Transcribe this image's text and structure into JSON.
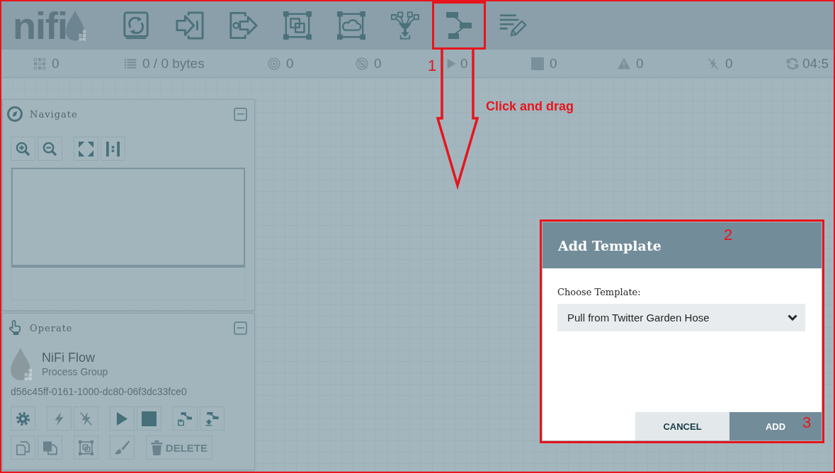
{
  "header": {
    "logo": "nifi",
    "toolbar": [
      {
        "kind": "processor",
        "highlighted": false
      },
      {
        "kind": "input-port",
        "highlighted": false
      },
      {
        "kind": "output-port",
        "highlighted": false
      },
      {
        "kind": "process-group",
        "highlighted": false
      },
      {
        "kind": "remote-process-group",
        "highlighted": false
      },
      {
        "kind": "funnel",
        "highlighted": false
      },
      {
        "kind": "template",
        "highlighted": true
      },
      {
        "kind": "label",
        "highlighted": false
      }
    ]
  },
  "status_bar": [
    {
      "kind": "components",
      "value": "0"
    },
    {
      "kind": "queued",
      "value": "0 / 0 bytes"
    },
    {
      "kind": "transmitting",
      "value": "0"
    },
    {
      "kind": "not-transmitting",
      "value": "0"
    },
    {
      "kind": "running",
      "value": "0"
    },
    {
      "kind": "stopped",
      "value": "0"
    },
    {
      "kind": "invalid",
      "value": "0"
    },
    {
      "kind": "disabled",
      "value": "0"
    },
    {
      "kind": "refreshed",
      "value": "04:5"
    }
  ],
  "navigate_panel": {
    "title": "Navigate",
    "expanded": true,
    "button_groups": [
      [
        {
          "kind": "zoom-in"
        },
        {
          "kind": "zoom-out"
        }
      ],
      [
        {
          "kind": "fit"
        },
        {
          "kind": "actual-size"
        }
      ]
    ]
  },
  "operate_panel": {
    "title": "Operate",
    "expanded": true,
    "component": {
      "name": "NiFi Flow",
      "type": "Process Group",
      "id": "d56c45ff-0161-1000-dc80-06f3dc33fce0"
    },
    "button_rows": [
      [
        [
          {
            "kind": "configure",
            "disabled": false
          }
        ],
        [
          {
            "kind": "enable",
            "disabled": true
          },
          {
            "kind": "disable",
            "disabled": true
          }
        ],
        [
          {
            "kind": "start",
            "disabled": false
          },
          {
            "kind": "stop",
            "disabled": false
          }
        ],
        [
          {
            "kind": "create-template",
            "disabled": false
          },
          {
            "kind": "upload-template",
            "disabled": false
          }
        ]
      ],
      [
        [
          {
            "kind": "copy",
            "disabled": true
          },
          {
            "kind": "paste",
            "disabled": true
          }
        ],
        [
          {
            "kind": "group",
            "disabled": true
          }
        ],
        [
          {
            "kind": "color",
            "disabled": true
          }
        ],
        [
          {
            "kind": "delete",
            "label": "DELETE",
            "disabled": true
          }
        ]
      ]
    ]
  },
  "dialog": {
    "title": "Add Template",
    "field_label": "Choose Template:",
    "selected_template": "Pull from Twitter Garden Hose",
    "buttons": [
      {
        "kind": "cancel",
        "label": "CANCEL"
      },
      {
        "kind": "confirm",
        "label": "ADD"
      }
    ]
  },
  "annotations": {
    "steps": [
      "1",
      "2",
      "3"
    ],
    "instruction": "Click and drag"
  }
}
